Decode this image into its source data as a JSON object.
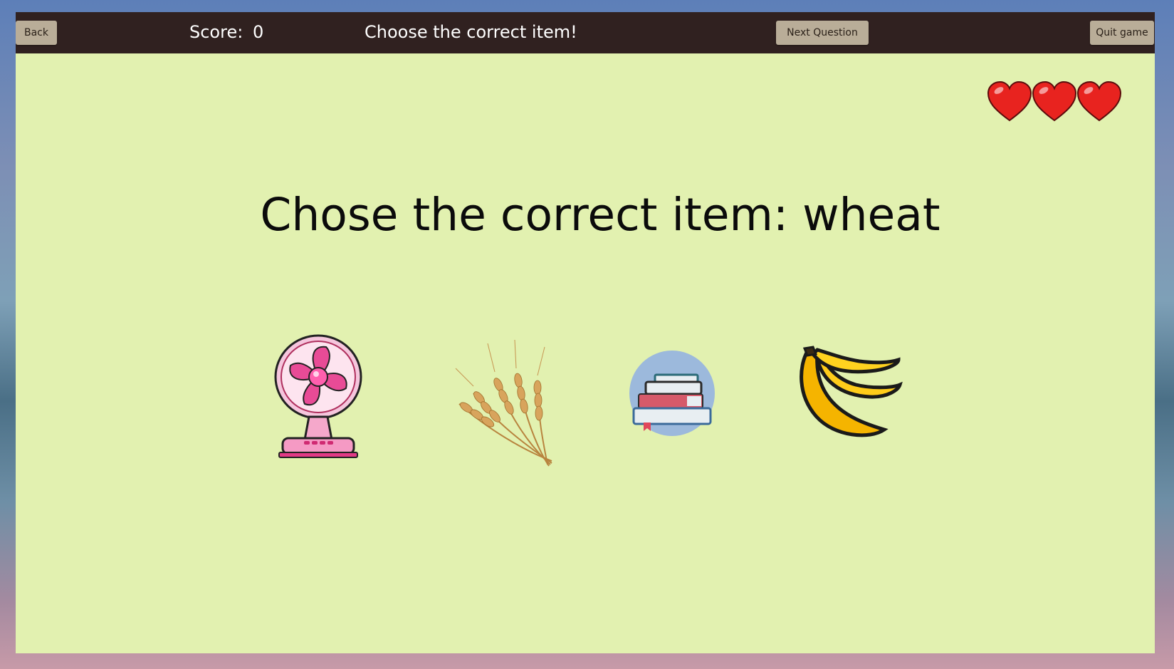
{
  "topbar": {
    "back_label": "Back",
    "score_label": "Score:",
    "score_value": "0",
    "title": "Choose the correct item!",
    "next_label": "Next Question",
    "quit_label": "Quit game"
  },
  "lives": {
    "count": 3,
    "max": 3,
    "icon": "heart-icon",
    "color": "#e8231f"
  },
  "question": {
    "text": "Chose the correct item: wheat"
  },
  "choices": [
    {
      "id": "fan",
      "icon": "fan-icon"
    },
    {
      "id": "wheat",
      "icon": "wheat-icon"
    },
    {
      "id": "books",
      "icon": "books-icon"
    },
    {
      "id": "banana",
      "icon": "banana-icon"
    }
  ],
  "colors": {
    "topbar": "#302120",
    "background": "#e2f1b0",
    "button": "#b9ad98"
  }
}
